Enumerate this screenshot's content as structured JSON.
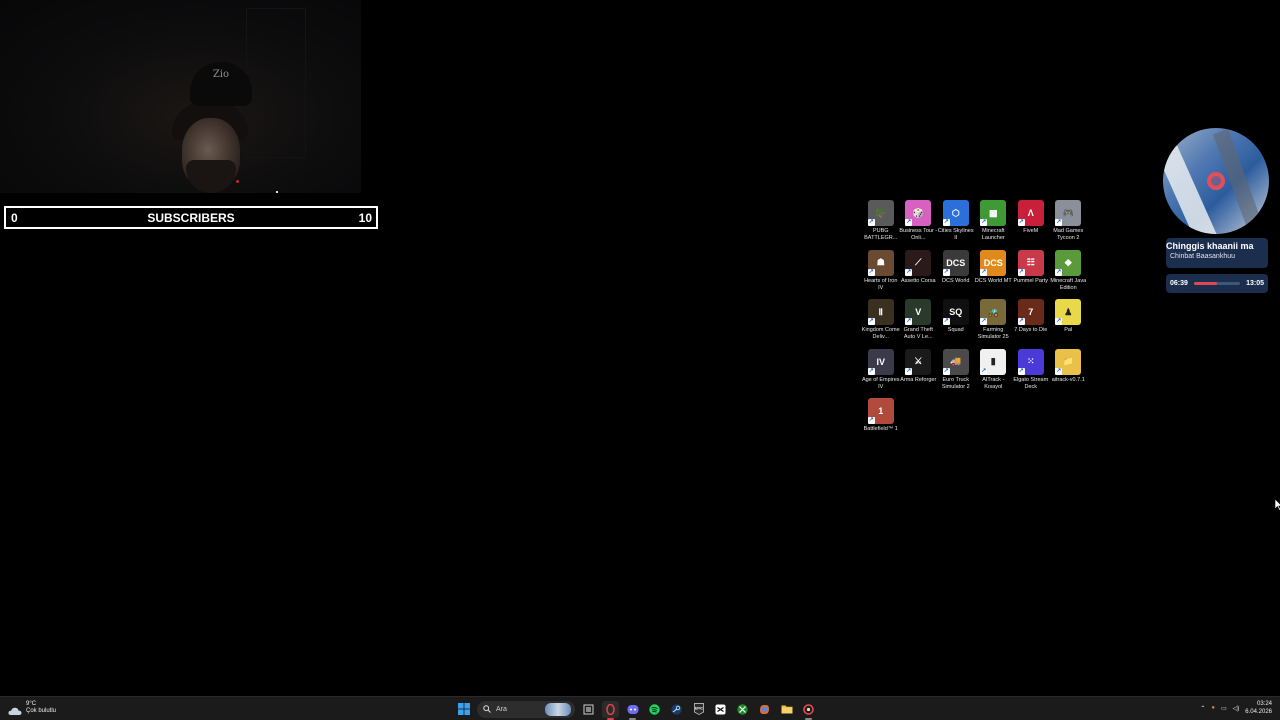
{
  "webcam": {
    "cap_text": "Zio"
  },
  "subscriber_goal": {
    "start": "0",
    "label": "SUBSCRIBERS",
    "goal": "10"
  },
  "desktop_icons": [
    {
      "label": "PUBG BATTLEGR...",
      "color": "#5a5a5a",
      "glyph": "🪖"
    },
    {
      "label": "Business Tour - Onli...",
      "color": "#d860c0",
      "glyph": "🎲"
    },
    {
      "label": "Cities Skylines II",
      "color": "#2b6fd8",
      "glyph": "⬡"
    },
    {
      "label": "Minecraft Launcher",
      "color": "#3f9a36",
      "glyph": "▩"
    },
    {
      "label": "FiveM",
      "color": "#c8203a",
      "glyph": "Λ"
    },
    {
      "label": "Mad Games Tycoon 2",
      "color": "#8a8f9a",
      "glyph": "🎮"
    },
    {
      "label": "Hearts of Iron IV",
      "color": "#6a4a30",
      "glyph": "☗"
    },
    {
      "label": "Assetto Corsa",
      "color": "#2a1a1a",
      "glyph": "⟋"
    },
    {
      "label": "DCS World",
      "color": "#3a3a3a",
      "glyph": "DCS"
    },
    {
      "label": "DCS World MT",
      "color": "#e08a1c",
      "glyph": "DCS"
    },
    {
      "label": "Pummel Party",
      "color": "#c83a4a",
      "glyph": "☷"
    },
    {
      "label": "Minecraft Java Edition",
      "color": "#5a9a3a",
      "glyph": "◆"
    },
    {
      "label": "Kingdom Come Deliv...",
      "color": "#3a3020",
      "glyph": "Ⅱ"
    },
    {
      "label": "Grand Theft Auto V Le...",
      "color": "#2a3a2a",
      "glyph": "V"
    },
    {
      "label": "Squad",
      "color": "#101010",
      "glyph": "SQ"
    },
    {
      "label": "Farming Simulator 25",
      "color": "#7a6a3a",
      "glyph": "🚜"
    },
    {
      "label": "7 Days to Die",
      "color": "#6a2a1a",
      "glyph": "7"
    },
    {
      "label": "Pal",
      "color": "#e8d84a",
      "glyph": "♟"
    },
    {
      "label": "Age of Empires IV",
      "color": "#3a3a4a",
      "glyph": "IV"
    },
    {
      "label": "Arma Reforger",
      "color": "#1a1a1a",
      "glyph": "⚔"
    },
    {
      "label": "Euro Truck Simulator 2",
      "color": "#4a4a4a",
      "glyph": "🚚"
    },
    {
      "label": "AITrack - Kısayol",
      "color": "#f0f0f0",
      "glyph": "▮"
    },
    {
      "label": "Elgato Stream Deck",
      "color": "#4a3ad8",
      "glyph": "⁙"
    },
    {
      "label": "aitrack-v0.7.1",
      "color": "#e8c04a",
      "glyph": "📁"
    },
    {
      "label": "Battlefield™ 1",
      "color": "#b04a3a",
      "glyph": "1"
    }
  ],
  "music_widget": {
    "song": "Chinggis khaanii ma",
    "artist": "Chinbat Baasankhuu",
    "elapsed": "06:39",
    "total": "13:05",
    "progress_fraction": 0.51
  },
  "taskbar": {
    "weather_temp": "9°C",
    "weather_desc": "Çok bulutlu",
    "search_placeholder": "Ara",
    "time": "03:24",
    "date": "6.04.2026"
  }
}
